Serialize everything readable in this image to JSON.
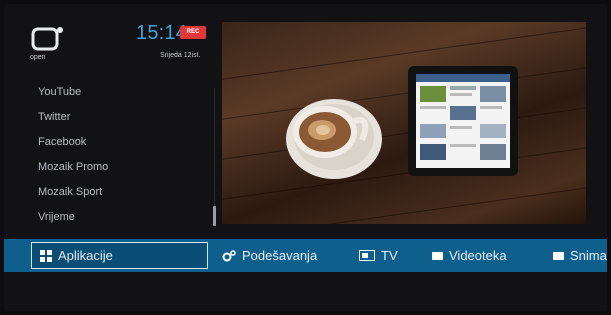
{
  "logo": {
    "text": "open"
  },
  "status": {
    "time": "15:14",
    "rec_badge": "REC",
    "date": "Srijeda 12ist."
  },
  "apps": [
    {
      "label": "YouTube"
    },
    {
      "label": "Twitter"
    },
    {
      "label": "Facebook"
    },
    {
      "label": "Mozaik Promo"
    },
    {
      "label": "Mozaik Sport"
    },
    {
      "label": "Vrijeme"
    }
  ],
  "menu": [
    {
      "label": "Aplikacije",
      "icon": "grid-icon",
      "active": true
    },
    {
      "label": "Podešavanja",
      "icon": "gear-icon"
    },
    {
      "label": "TV",
      "icon": "tv-icon"
    },
    {
      "label": "Videoteka",
      "icon": "video-icon"
    },
    {
      "label": "Snima",
      "icon": "record-icon"
    }
  ],
  "colors": {
    "accent": "#0f5f8d",
    "clock": "#3fa3dd",
    "badge": "#e2383a"
  }
}
